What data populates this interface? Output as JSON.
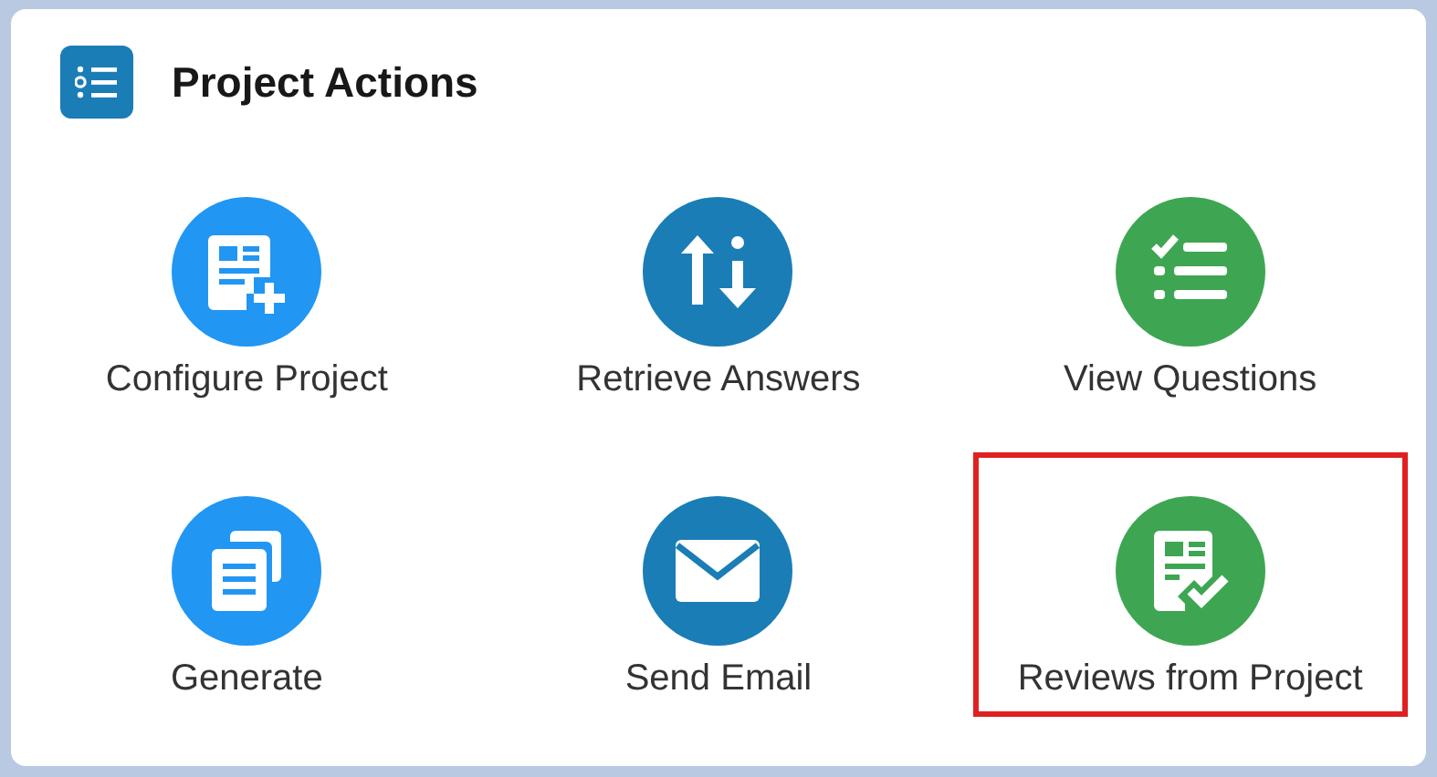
{
  "card": {
    "title": "Project Actions"
  },
  "actions": [
    {
      "label": "Configure Project",
      "color": "#2196f3",
      "highlighted": false
    },
    {
      "label": "Retrieve Answers",
      "color": "#1a7db6",
      "highlighted": false
    },
    {
      "label": "View Questions",
      "color": "#3ea652",
      "highlighted": false
    },
    {
      "label": "Generate",
      "color": "#2196f3",
      "highlighted": false
    },
    {
      "label": "Send Email",
      "color": "#1a7db6",
      "highlighted": false
    },
    {
      "label": "Reviews from Project",
      "color": "#3ea652",
      "highlighted": true
    }
  ]
}
